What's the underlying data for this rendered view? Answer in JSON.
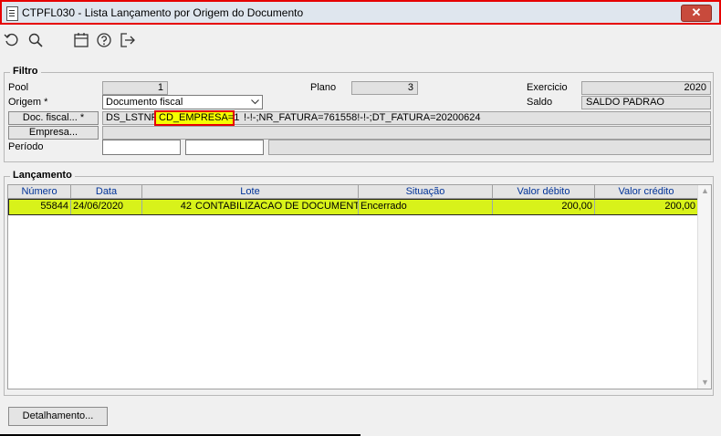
{
  "window": {
    "title": "CTPFL030 - Lista Lançamento por Origem do Documento",
    "close_label": "✕"
  },
  "toolbar": {
    "icons": [
      "undo-icon",
      "search-icon",
      "calendar-icon",
      "help-icon",
      "exit-icon"
    ]
  },
  "filtro": {
    "legend": "Filtro",
    "pool_label": "Pool",
    "pool_value": "1",
    "plano_label": "Plano",
    "plano_value": "3",
    "exercicio_label": "Exercicio",
    "exercicio_value": "2020",
    "origem_label": "Origem *",
    "origem_value": "Documento fiscal",
    "saldo_label": "Saldo",
    "saldo_value": "SALDO PADRAO",
    "doc_fiscal_button": "Doc. fiscal... *",
    "doc_text_prefix": "DS_LSTNF=",
    "doc_text_highlight": "CD_EMPRESA=1",
    "doc_text_suffix": "!-!-;NR_FATURA=761558!-!-;DT_FATURA=20200624",
    "empresa_button": "Empresa...",
    "periodo_label": "Período"
  },
  "lancamento": {
    "legend": "Lançamento",
    "columns": [
      "Número",
      "Data",
      "Lote",
      "Situação",
      "Valor débito",
      "Valor crédito"
    ],
    "rows": [
      {
        "numero": "55844",
        "data": "24/06/2020",
        "lote_num": "42",
        "lote_desc": "CONTABILIZACAO DE DOCUMENTOS",
        "situacao": "Encerrado",
        "debito": "200,00",
        "credito": "200,00"
      }
    ]
  },
  "footer": {
    "detalhamento_button": "Detalhamento..."
  }
}
